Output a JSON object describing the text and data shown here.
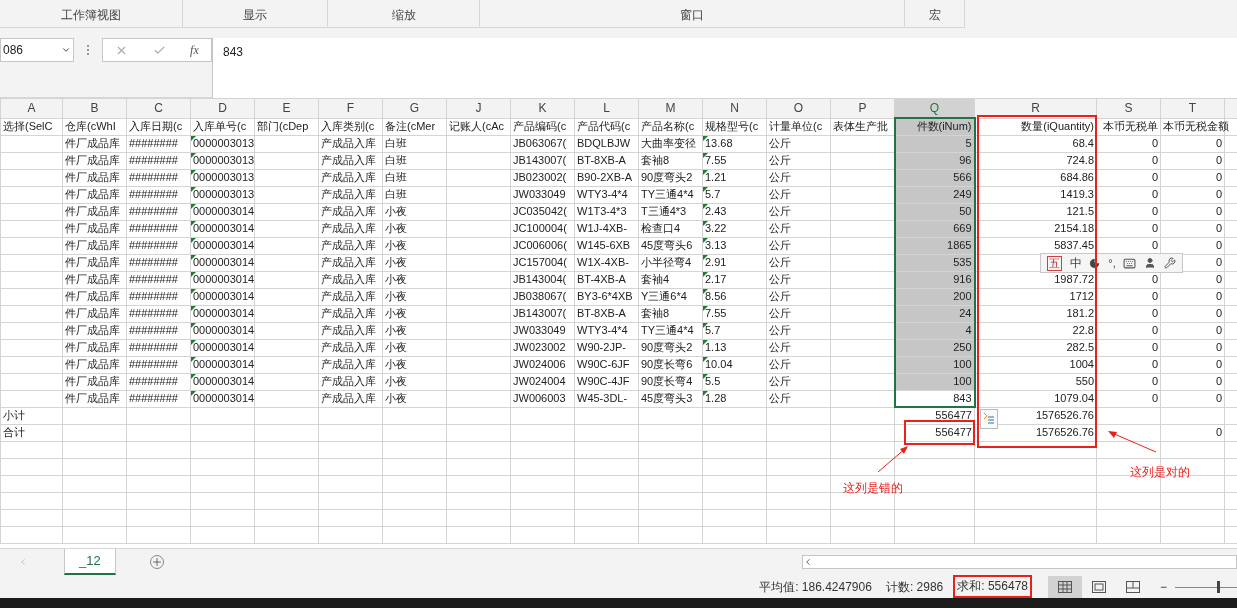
{
  "ribbon": {
    "groups": [
      {
        "label": "工作簿视图"
      },
      {
        "label": "显示"
      },
      {
        "label": "缩放"
      },
      {
        "label": "窗口"
      },
      {
        "label": "宏"
      }
    ]
  },
  "formula_bar": {
    "name_box": "086",
    "function_label": "fx",
    "value": "843"
  },
  "columns": [
    {
      "letter": "A",
      "kind": "text",
      "selected": false,
      "text_flag": false
    },
    {
      "letter": "B",
      "kind": "text",
      "selected": false,
      "text_flag": false
    },
    {
      "letter": "C",
      "kind": "text",
      "selected": false,
      "text_flag": false
    },
    {
      "letter": "D",
      "kind": "text",
      "selected": false,
      "text_flag": true
    },
    {
      "letter": "E",
      "kind": "text",
      "selected": false,
      "text_flag": false
    },
    {
      "letter": "F",
      "kind": "text",
      "selected": false,
      "text_flag": false
    },
    {
      "letter": "G",
      "kind": "text",
      "selected": false,
      "text_flag": false
    },
    {
      "letter": "J",
      "kind": "text",
      "selected": false,
      "text_flag": false
    },
    {
      "letter": "K",
      "kind": "text",
      "selected": false,
      "text_flag": false
    },
    {
      "letter": "L",
      "kind": "text",
      "selected": false,
      "text_flag": false
    },
    {
      "letter": "M",
      "kind": "text",
      "selected": false,
      "text_flag": false
    },
    {
      "letter": "N",
      "kind": "text",
      "selected": false,
      "text_flag": true
    },
    {
      "letter": "O",
      "kind": "text",
      "selected": false,
      "text_flag": false
    },
    {
      "letter": "P",
      "kind": "text",
      "selected": false,
      "text_flag": false
    },
    {
      "letter": "Q",
      "kind": "number",
      "selected": true,
      "text_flag": false
    },
    {
      "letter": "R",
      "kind": "number",
      "selected": false,
      "text_flag": false
    },
    {
      "letter": "S",
      "kind": "number",
      "selected": false,
      "text_flag": false
    },
    {
      "letter": "T",
      "kind": "number",
      "selected": false,
      "text_flag": false
    }
  ],
  "rows": [
    {
      "selected": true,
      "active": false,
      "kind": "header",
      "cells": {
        "A": "选择(SelC",
        "B": "仓库(cWhI",
        "C": "入库日期(c",
        "D": "入库单号(c",
        "E": "部门(cDep",
        "F": "入库类别(c",
        "G": "备注(cMer",
        "J": "记账人(cAc",
        "K": "产品编码(c",
        "L": "产品代码(c",
        "M": "产品名称(c",
        "N": "规格型号(c",
        "O": "计量单位(c",
        "P": "表体生产批",
        "Q": "件数(iNum)",
        "R": "数量(iQuantity)",
        "S": "本币无税单",
        "T": "本币无税金额"
      }
    },
    {
      "selected": true,
      "active": false,
      "kind": "data",
      "cells": {
        "B": "件厂成品库",
        "C": "########",
        "D": "0000003013",
        "F": "产成品入库",
        "G": "白班",
        "K": "JB063067(",
        "L": "BDQLBJW",
        "M": "大曲率变径",
        "N": "13.68",
        "O": "公斤",
        "Q": "5",
        "R": "68.4",
        "S": "0",
        "T": "0"
      }
    },
    {
      "selected": true,
      "active": false,
      "kind": "data",
      "cells": {
        "B": "件厂成品库",
        "C": "########",
        "D": "0000003013",
        "F": "产成品入库",
        "G": "白班",
        "K": "JB143007(",
        "L": "BT-8XB-A",
        "M": "套袖8",
        "N": "7.55",
        "O": "公斤",
        "Q": "96",
        "R": "724.8",
        "S": "0",
        "T": "0"
      }
    },
    {
      "selected": true,
      "active": false,
      "kind": "data",
      "cells": {
        "B": "件厂成品库",
        "C": "########",
        "D": "0000003013",
        "F": "产成品入库",
        "G": "白班",
        "K": "JB023002(",
        "L": "B90-2XB-A",
        "M": "90度弯头2",
        "N": "1.21",
        "O": "公斤",
        "Q": "566",
        "R": "684.86",
        "S": "0",
        "T": "0"
      }
    },
    {
      "selected": true,
      "active": false,
      "kind": "data",
      "cells": {
        "B": "件厂成品库",
        "C": "########",
        "D": "0000003013",
        "F": "产成品入库",
        "G": "白班",
        "K": "JW033049",
        "L": "WTY3-4*4",
        "M": "TY三通4*4",
        "N": "5.7",
        "O": "公斤",
        "Q": "249",
        "R": "1419.3",
        "S": "0",
        "T": "0"
      }
    },
    {
      "selected": true,
      "active": false,
      "kind": "data",
      "cells": {
        "B": "件厂成品库",
        "C": "########",
        "D": "0000003014",
        "F": "产成品入库",
        "G": "小夜",
        "K": "JC035042(",
        "L": "W1T3-4*3",
        "M": "T三通4*3",
        "N": "2.43",
        "O": "公斤",
        "Q": "50",
        "R": "121.5",
        "S": "0",
        "T": "0"
      }
    },
    {
      "selected": true,
      "active": false,
      "kind": "data",
      "cells": {
        "B": "件厂成品库",
        "C": "########",
        "D": "0000003014",
        "F": "产成品入库",
        "G": "小夜",
        "K": "JC100004(",
        "L": "W1J-4XB-",
        "M": "检查口4",
        "N": "3.22",
        "O": "公斤",
        "Q": "669",
        "R": "2154.18",
        "S": "0",
        "T": "0"
      }
    },
    {
      "selected": true,
      "active": false,
      "kind": "data",
      "cells": {
        "B": "件厂成品库",
        "C": "########",
        "D": "0000003014",
        "F": "产成品入库",
        "G": "小夜",
        "K": "JC006006(",
        "L": "W145-6XB",
        "M": "45度弯头6",
        "N": "3.13",
        "O": "公斤",
        "Q": "1865",
        "R": "5837.45",
        "S": "0",
        "T": "0"
      }
    },
    {
      "selected": true,
      "active": false,
      "kind": "data",
      "cells": {
        "B": "件厂成品库",
        "C": "########",
        "D": "0000003014",
        "F": "产成品入库",
        "G": "小夜",
        "K": "JC157004(",
        "L": "W1X-4XB-",
        "M": "小半径弯4",
        "N": "2.91",
        "O": "公斤",
        "Q": "535",
        "T": "0"
      }
    },
    {
      "selected": true,
      "active": false,
      "kind": "data",
      "cells": {
        "B": "件厂成品库",
        "C": "########",
        "D": "0000003014",
        "F": "产成品入库",
        "G": "小夜",
        "K": "JB143004(",
        "L": "BT-4XB-A",
        "M": "套袖4",
        "N": "2.17",
        "O": "公斤",
        "Q": "916",
        "R": "1987.72",
        "S": "0",
        "T": "0"
      }
    },
    {
      "selected": true,
      "active": false,
      "kind": "data",
      "cells": {
        "B": "件厂成品库",
        "C": "########",
        "D": "0000003014",
        "F": "产成品入库",
        "G": "小夜",
        "K": "JB038067(",
        "L": "BY3-6*4XB",
        "M": "Y三通6*4",
        "N": "8.56",
        "O": "公斤",
        "Q": "200",
        "R": "1712",
        "S": "0",
        "T": "0"
      }
    },
    {
      "selected": true,
      "active": false,
      "kind": "data",
      "cells": {
        "B": "件厂成品库",
        "C": "########",
        "D": "0000003014",
        "F": "产成品入库",
        "G": "小夜",
        "K": "JB143007(",
        "L": "BT-8XB-A",
        "M": "套袖8",
        "N": "7.55",
        "O": "公斤",
        "Q": "24",
        "R": "181.2",
        "S": "0",
        "T": "0"
      }
    },
    {
      "selected": true,
      "active": false,
      "kind": "data",
      "cells": {
        "B": "件厂成品库",
        "C": "########",
        "D": "0000003014",
        "F": "产成品入库",
        "G": "小夜",
        "K": "JW033049",
        "L": "WTY3-4*4",
        "M": "TY三通4*4",
        "N": "5.7",
        "O": "公斤",
        "Q": "4",
        "R": "22.8",
        "S": "0",
        "T": "0"
      }
    },
    {
      "selected": true,
      "active": false,
      "kind": "data",
      "cells": {
        "B": "件厂成品库",
        "C": "########",
        "D": "0000003014",
        "F": "产成品入库",
        "G": "小夜",
        "K": "JW023002",
        "L": "W90-2JP-",
        "M": "90度弯头2",
        "N": "1.13",
        "O": "公斤",
        "Q": "250",
        "R": "282.5",
        "S": "0",
        "T": "0"
      }
    },
    {
      "selected": true,
      "active": false,
      "kind": "data",
      "cells": {
        "B": "件厂成品库",
        "C": "########",
        "D": "0000003014",
        "F": "产成品入库",
        "G": "小夜",
        "K": "JW024006",
        "L": "W90C-6JF",
        "M": "90度长弯6",
        "N": "10.04",
        "O": "公斤",
        "Q": "100",
        "R": "1004",
        "S": "0",
        "T": "0"
      }
    },
    {
      "selected": true,
      "active": false,
      "kind": "data",
      "cells": {
        "B": "件厂成品库",
        "C": "########",
        "D": "0000003014",
        "F": "产成品入库",
        "G": "小夜",
        "K": "JW024004",
        "L": "W90C-4JF",
        "M": "90度长弯4",
        "N": "5.5",
        "O": "公斤",
        "Q": "100",
        "R": "550",
        "S": "0",
        "T": "0"
      }
    },
    {
      "selected": true,
      "active": true,
      "kind": "data",
      "cells": {
        "B": "件厂成品库",
        "C": "########",
        "D": "0000003014",
        "F": "产成品入库",
        "G": "小夜",
        "K": "JW006003",
        "L": "W45-3DL-",
        "M": "45度弯头3",
        "N": "1.28",
        "O": "公斤",
        "Q": "843",
        "R": "1079.04",
        "S": "0",
        "T": "0"
      }
    },
    {
      "selected": false,
      "active": false,
      "kind": "total",
      "cells": {
        "A": "小计",
        "Q": "556477",
        "R": "1576526.76"
      }
    },
    {
      "selected": false,
      "active": false,
      "kind": "total",
      "cells": {
        "A": "合计",
        "Q": "556477",
        "R": "1576526.76",
        "T": "0"
      }
    }
  ],
  "ime_toolbar": {
    "items": [
      "五",
      "中",
      "°,"
    ]
  },
  "annotations": [
    {
      "text": "这列是错的"
    },
    {
      "text": "这列是对的"
    }
  ],
  "sheet_tabs": [
    {
      "label": "_12",
      "selected": true
    }
  ],
  "status_bar": {
    "average": "平均值: 186.4247906",
    "count": "计数: 2986",
    "sum": "求和: 556478",
    "views": [
      {
        "kind": "normal",
        "selected": true
      },
      {
        "kind": "page_layout",
        "selected": false
      },
      {
        "kind": "page_break",
        "selected": false
      }
    ],
    "zoom_out": "−",
    "zoom": {
      "level": 0.68
    }
  }
}
